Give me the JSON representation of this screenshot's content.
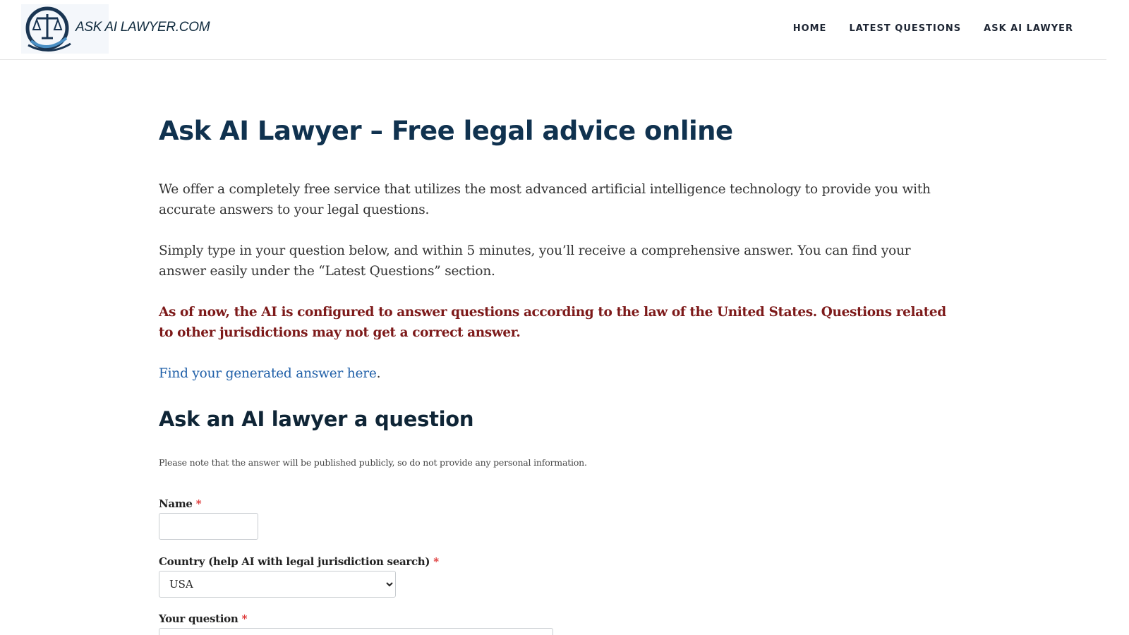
{
  "header": {
    "logo_text": "ASK AI LAWYER.COM",
    "nav": [
      {
        "label": "HOME"
      },
      {
        "label": "LATEST QUESTIONS"
      },
      {
        "label": "ASK AI LAWYER"
      }
    ]
  },
  "main": {
    "title": "Ask AI Lawyer – Free legal advice online",
    "intro": "We offer a completely free service that utilizes the most advanced artificial intelligence technology to provide you with accurate answers to your legal questions.",
    "instructions": "Simply type in your question below, and within 5 minutes, you’ll receive a comprehensive answer. You can find your answer easily under the “Latest Questions” section.",
    "warning": "As of now, the AI is configured to answer questions according to the law of the United States. Questions related to other jurisdictions may not get a correct answer.",
    "answer_link": "Find your generated answer here",
    "answer_link_suffix": ".",
    "form_heading": "Ask an AI lawyer a question",
    "privacy_note": "Please note that the answer will be published publicly, so do not provide any personal information."
  },
  "form": {
    "name_label": "Name",
    "name_value": "",
    "country_label": "Country (help AI with legal jurisdiction search)",
    "country_selected": "USA",
    "question_label": "Your question",
    "question_value": "",
    "required_marker": "*"
  },
  "colors": {
    "title": "#10324f",
    "warning": "#7d1a1a",
    "link": "#1f5fa8",
    "required": "#dd3333"
  },
  "icons": {
    "logo": "scales-of-justice-icon"
  }
}
